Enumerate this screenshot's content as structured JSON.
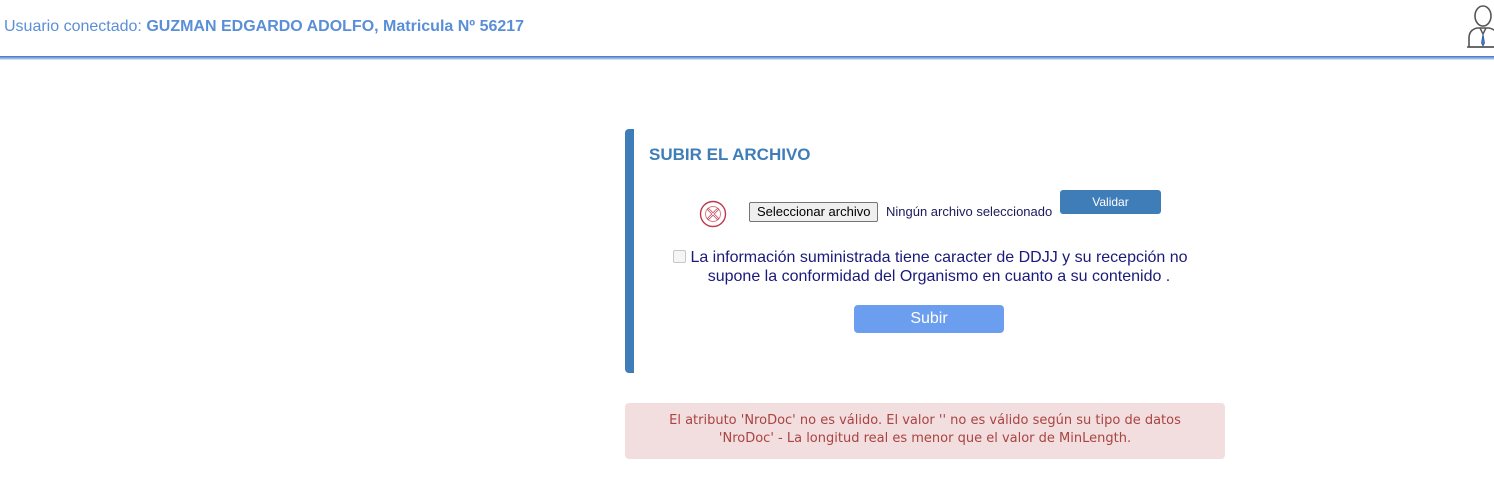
{
  "header": {
    "user_prefix": "Usuario conectado:",
    "user_name": "GUZMAN EDGARDO ADOLFO, Matricula Nº 56217",
    "user_icon": "user-profile-icon"
  },
  "upload_panel": {
    "title": "SUBIR EL ARCHIVO",
    "status_icon": "error-circle-x-icon",
    "file_button_label": "Seleccionar archivo",
    "file_status": "Ningún archivo seleccionado",
    "validate_label": "Validar",
    "declaration_checked": false,
    "declaration_text": "La información suministrada tiene caracter de DDJJ y su recepción no supone la conformidad del Organismo en cuanto a su contenido .",
    "submit_label": "Subir"
  },
  "error_message": {
    "line1": "El atributo 'NroDoc' no es válido. El valor '' no es válido según su tipo de datos",
    "line2": "'NroDoc' - La longitud real es menor que el valor de MinLength."
  },
  "colors": {
    "accent_blue": "#3f7db9",
    "user_text": "#5a8fd8",
    "submit_blue": "#6c9ef0",
    "error_bg": "#f2dede",
    "error_text": "#a94442",
    "status_icon_red": "#c0394f"
  }
}
